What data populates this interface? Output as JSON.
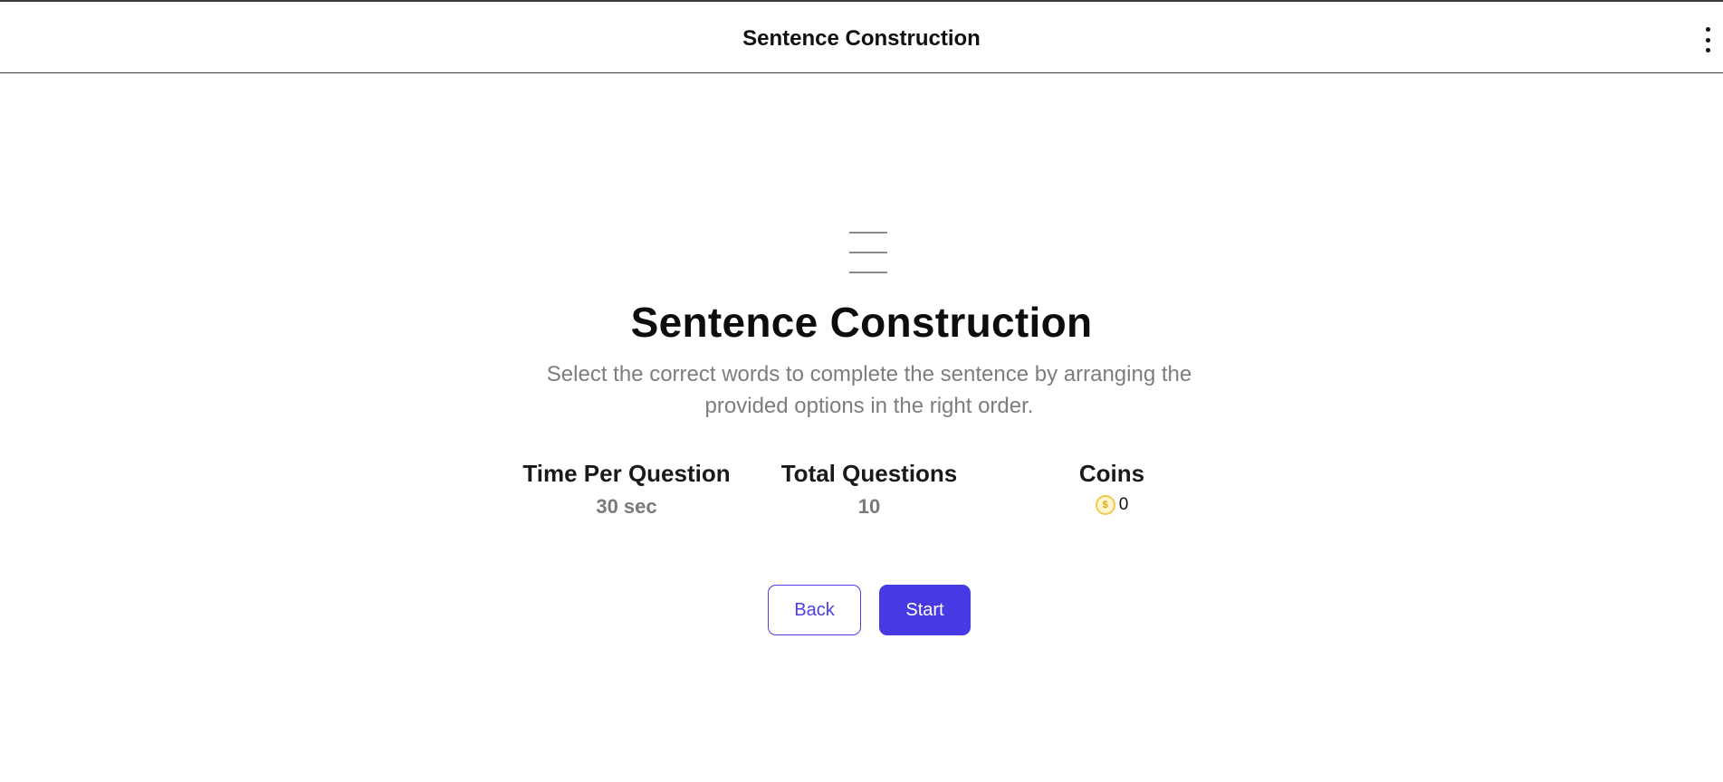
{
  "header": {
    "title": "Sentence Construction",
    "menu_icon": "kebab-menu-icon"
  },
  "hero": {
    "icon": "list-lines-icon",
    "title": "Sentence Construction",
    "description": "Select the correct words to complete the sentence by arranging the provided options in the right order."
  },
  "stats": {
    "time_per_question": {
      "label": "Time Per Question",
      "value": "30 sec"
    },
    "total_questions": {
      "label": "Total Questions",
      "value": "10"
    },
    "coins": {
      "label": "Coins",
      "value": "0",
      "icon": "coin-icon",
      "icon_glyph": "$"
    }
  },
  "actions": {
    "back_label": "Back",
    "start_label": "Start"
  },
  "colors": {
    "accent": "#4739e4",
    "coin": "#f2c94c",
    "muted_text": "#7d7d7d"
  }
}
